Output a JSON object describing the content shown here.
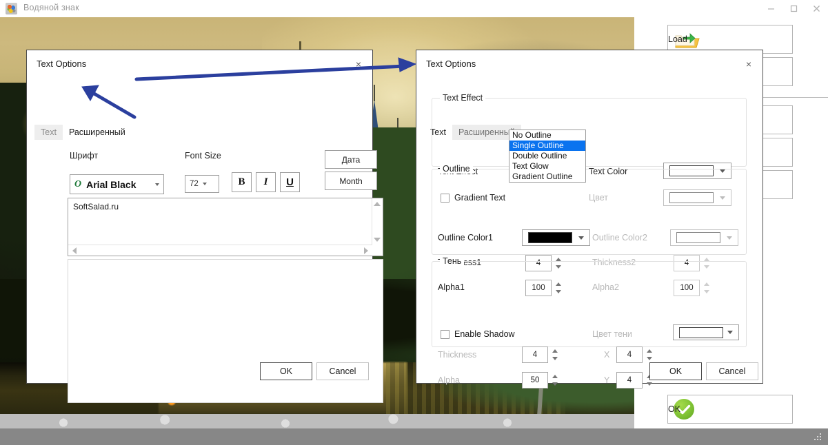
{
  "window": {
    "title": "Водяной знак",
    "icon": "app-icon",
    "minimize": "minimize-icon",
    "maximize": "maximize-icon",
    "close": "close-icon"
  },
  "side_panel": {
    "load_label": "Load",
    "ok_label": "OK",
    "load_icon": "open-folder-icon",
    "ok_icon": "green-check-icon"
  },
  "left_dialog": {
    "title": "Text Options",
    "close": "×",
    "tabs": [
      {
        "label": "Text",
        "state": "inactive"
      },
      {
        "label": "Расширенный",
        "state": "active"
      }
    ],
    "font_label": "Шрифт",
    "font_value": "Arial Black",
    "font_badge": "O",
    "font_size_label": "Font Size",
    "font_size_value": "72",
    "bold": "B",
    "italic": "I",
    "underline": "U",
    "date_button": "Дата",
    "month_button": "Month",
    "text_value": "SoftSalad.ru",
    "ok": "OK",
    "cancel": "Cancel"
  },
  "right_dialog": {
    "title": "Text Options",
    "close": "×",
    "tabs": [
      {
        "label": "Text",
        "state": "active"
      },
      {
        "label": "Расширенный",
        "state": "greyactive"
      }
    ],
    "text_effect_group": {
      "title": "Text Effect",
      "effect_label": "Text Effect",
      "effect_value": "Single Outline",
      "text_color_label": "Text Color",
      "text_color_value": "#FFFFFF",
      "gradient_text_label": "Gradient Text",
      "gradient_text_checked": false,
      "color2_label": "Цвет",
      "color2_value": "#FFFFFF"
    },
    "dropdown": {
      "open": true,
      "options": [
        "No Outline",
        "Single Outline",
        "Double Outline",
        "Text Glow",
        "Gradient Outline"
      ],
      "selected": "Single Outline",
      "selected_index": 1
    },
    "outline_group": {
      "title": "Outline",
      "color1_label": "Outline Color1",
      "color1_value": "#000000",
      "color2_label": "Outline Color2",
      "color2_value": "#FFFFFF",
      "thickness1_label": "Thickness1",
      "thickness1_value": "4",
      "thickness2_label": "Thickness2",
      "thickness2_value": "4",
      "alpha1_label": "Alpha1",
      "alpha1_value": "100",
      "alpha2_label": "Alpha2",
      "alpha2_value": "100"
    },
    "shadow_group": {
      "title": "Тень",
      "enable_label": "Enable Shadow",
      "enable_checked": false,
      "color_label": "Цвет тени",
      "color_value": "#FFFFFF",
      "thickness_label": "Thickness",
      "thickness_value": "4",
      "alpha_label": "Alpha",
      "alpha_value": "50",
      "x_label": "X",
      "x_value": "4",
      "y_label": "Y",
      "y_value": "4"
    },
    "ok": "OK",
    "cancel": "Cancel"
  },
  "annotations": {
    "arrow_color": "#2b3f9e",
    "arrow_to_tab": "arrow-pointing-to-advanced-tab",
    "arrow_to_right_dialog": "arrow-pointing-to-right-dialog"
  }
}
